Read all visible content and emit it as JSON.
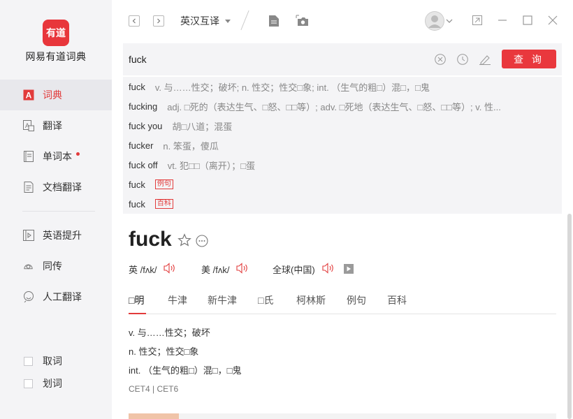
{
  "app": {
    "logo_text": "有道",
    "name": "网易有道词典"
  },
  "sidebar": {
    "items": [
      {
        "label": "词典",
        "icon": "dictionary-icon"
      },
      {
        "label": "翻译",
        "icon": "translate-icon"
      },
      {
        "label": "单词本",
        "icon": "wordbook-icon"
      },
      {
        "label": "文档翻译",
        "icon": "document-translate-icon"
      },
      {
        "label": "英语提升",
        "icon": "english-boost-icon"
      },
      {
        "label": "同传",
        "icon": "simultaneous-icon"
      },
      {
        "label": "人工翻译",
        "icon": "human-translate-icon"
      }
    ],
    "checks": [
      {
        "label": "取词"
      },
      {
        "label": "划词"
      }
    ],
    "accent": "#e23b3b"
  },
  "toolbar": {
    "language": "英汉互译"
  },
  "search": {
    "value": "fuck",
    "query_label": "查 询"
  },
  "suggestions": [
    {
      "word": "fuck",
      "def": "v. 与……性交；破坏; n. 性交；性交□象; int. （生气的粗□）混□，□鬼"
    },
    {
      "word": "fucking",
      "def": "adj. □死的（表达生气、□怒、□□等）; adv. □死地（表达生气、□怒、□□等）; v. 性..."
    },
    {
      "word": "fuck you",
      "def": "胡□八道；混蛋"
    },
    {
      "word": "fucker",
      "def": "n. 笨蛋，傻瓜"
    },
    {
      "word": "fuck off",
      "def": "vt. 犯□□（离开）；□蛋"
    },
    {
      "word": "fuck",
      "tag": "例句"
    },
    {
      "word": "fuck",
      "tag": "百科"
    }
  ],
  "entry": {
    "headword": "fuck",
    "phonetics": [
      {
        "label": "英 /fʌk/"
      },
      {
        "label": "美 /fʌk/"
      },
      {
        "label": "全球(中国)"
      }
    ],
    "tabs": [
      "□明",
      "牛津",
      "新牛津",
      "□氏",
      "柯林斯",
      "例句",
      "百科"
    ],
    "definitions": [
      "v. 与……性交；破坏",
      "n. 性交；性交□象",
      "int. （生气的粗□）混□，□鬼"
    ],
    "exam": "CET4 | CET6"
  }
}
